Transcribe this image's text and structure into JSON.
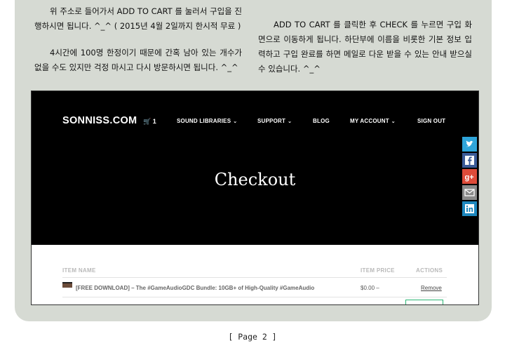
{
  "article": {
    "left_paragraphs": [
      "위 주소로 들어가서 ADD TO CART 를 눌러서 구입을 진행하시면 됩니다. ^_^ ( 2015년 4월 2일까지 한시적 무료 )",
      "4시간에 100명 한정이기 때문에 간혹 남아 있는 개수가 없을 수도 있지만 걱정 마시고 다시 방문하시면 됩니다. ^_^"
    ],
    "right_paragraph": "ADD TO CART 를 클릭한 후 CHECK 를 누르면 구입 화면으로 이동하게 됩니다. 하단부에 이름을 비롯한 기본 정보 입력하고 구입 완료를 하면 메일로 다운 받을 수 있는 안내 받으실 수 있습니다. ^_^"
  },
  "site": {
    "logo": "SONNISS.COM",
    "cart_count": "1",
    "nav": [
      {
        "label": "SOUND LIBRARIES",
        "has_dropdown": true
      },
      {
        "label": "SUPPORT",
        "has_dropdown": true
      },
      {
        "label": "BLOG",
        "has_dropdown": false
      },
      {
        "label": "MY ACCOUNT",
        "has_dropdown": true
      },
      {
        "label": "SIGN OUT",
        "has_dropdown": false
      }
    ],
    "hero_title": "Checkout"
  },
  "cart_table": {
    "headers": [
      "ITEM NAME",
      "ITEM PRICE",
      "ACTIONS"
    ],
    "rows": [
      {
        "name": "[FREE DOWNLOAD] – The #GameAudioGDC Bundle: 10GB+ of High-Quality #GameAudio",
        "price": "$0.00 –",
        "action": "Remove"
      }
    ]
  },
  "share_buttons": [
    {
      "name": "twitter",
      "icon": "twitter-icon",
      "color": "#2ea4d9"
    },
    {
      "name": "facebook",
      "icon": "facebook-icon",
      "color": "#3b5b98"
    },
    {
      "name": "google-plus",
      "icon": "google-plus-icon",
      "color": "#dd4b39"
    },
    {
      "name": "email",
      "icon": "email-icon",
      "color": "#8a8a8a"
    },
    {
      "name": "linkedin",
      "icon": "linkedin-icon",
      "color": "#1d87be"
    }
  ],
  "colors": {
    "panel_bg": "#d6dad3",
    "hero_bg": "#000000",
    "accent_green": "#2bb673"
  },
  "footer": {
    "page_label": "[ Page 2 ]"
  }
}
